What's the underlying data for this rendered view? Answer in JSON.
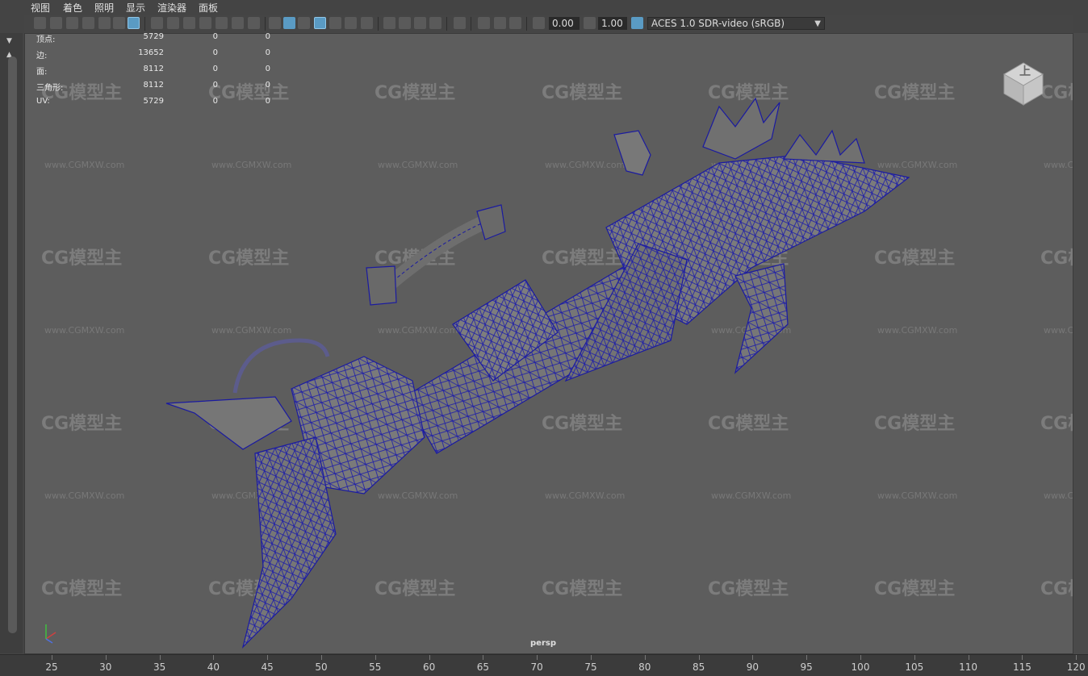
{
  "menu": [
    "视图",
    "着色",
    "照明",
    "显示",
    "渲染器",
    "面板"
  ],
  "toolbar": {
    "exposure_value": "0.00",
    "gamma_value": "1.00",
    "color_transform": "ACES 1.0 SDR-video (sRGB)"
  },
  "hud": {
    "rows": [
      {
        "label": "顶点:",
        "v1": "5729",
        "v2": "0",
        "v3": "0"
      },
      {
        "label": "边:",
        "v1": "13652",
        "v2": "0",
        "v3": "0"
      },
      {
        "label": "面:",
        "v1": "8112",
        "v2": "0",
        "v3": "0"
      },
      {
        "label": "三角形:",
        "v1": "8112",
        "v2": "0",
        "v3": "0"
      },
      {
        "label": "UV:",
        "v1": "5729",
        "v2": "0",
        "v3": "0"
      }
    ]
  },
  "viewcube_label": "上",
  "camera_label": "persp",
  "watermark": {
    "logo": "CG模型主",
    "url": "www.CGMXW.com"
  },
  "ruler_ticks": [
    "25",
    "30",
    "35",
    "40",
    "45",
    "50",
    "55",
    "60",
    "65",
    "70",
    "75",
    "80",
    "85",
    "90",
    "95",
    "100",
    "105",
    "110",
    "115",
    "120"
  ],
  "colors": {
    "wire": "#1a1aa0",
    "mesh": "#7a7a7a",
    "viewport_bg": "#5d5d5d"
  }
}
